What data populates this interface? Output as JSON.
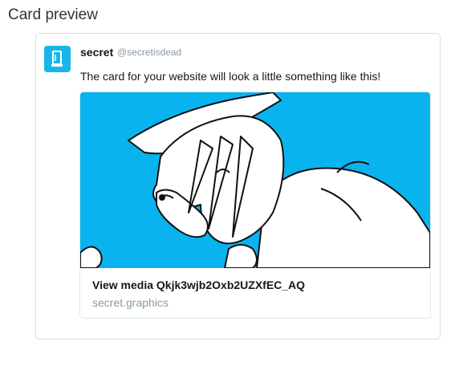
{
  "page": {
    "title": "Card preview"
  },
  "tweet": {
    "account_name": "secret",
    "account_handle": "@secretisdead",
    "text": "The card for your website will look a little something like this!",
    "avatar_icon": "phone-glyph-icon"
  },
  "card": {
    "image_icon": "illustration-image",
    "title": "View media Qkjk3wjb2Oxb2UZXfEC_AQ",
    "domain": "secret.graphics"
  },
  "colors": {
    "avatar_bg": "#19b6e9",
    "card_image_bg": "#09b4ee",
    "handle_text": "#8899a6",
    "border": "#d8dde1"
  }
}
